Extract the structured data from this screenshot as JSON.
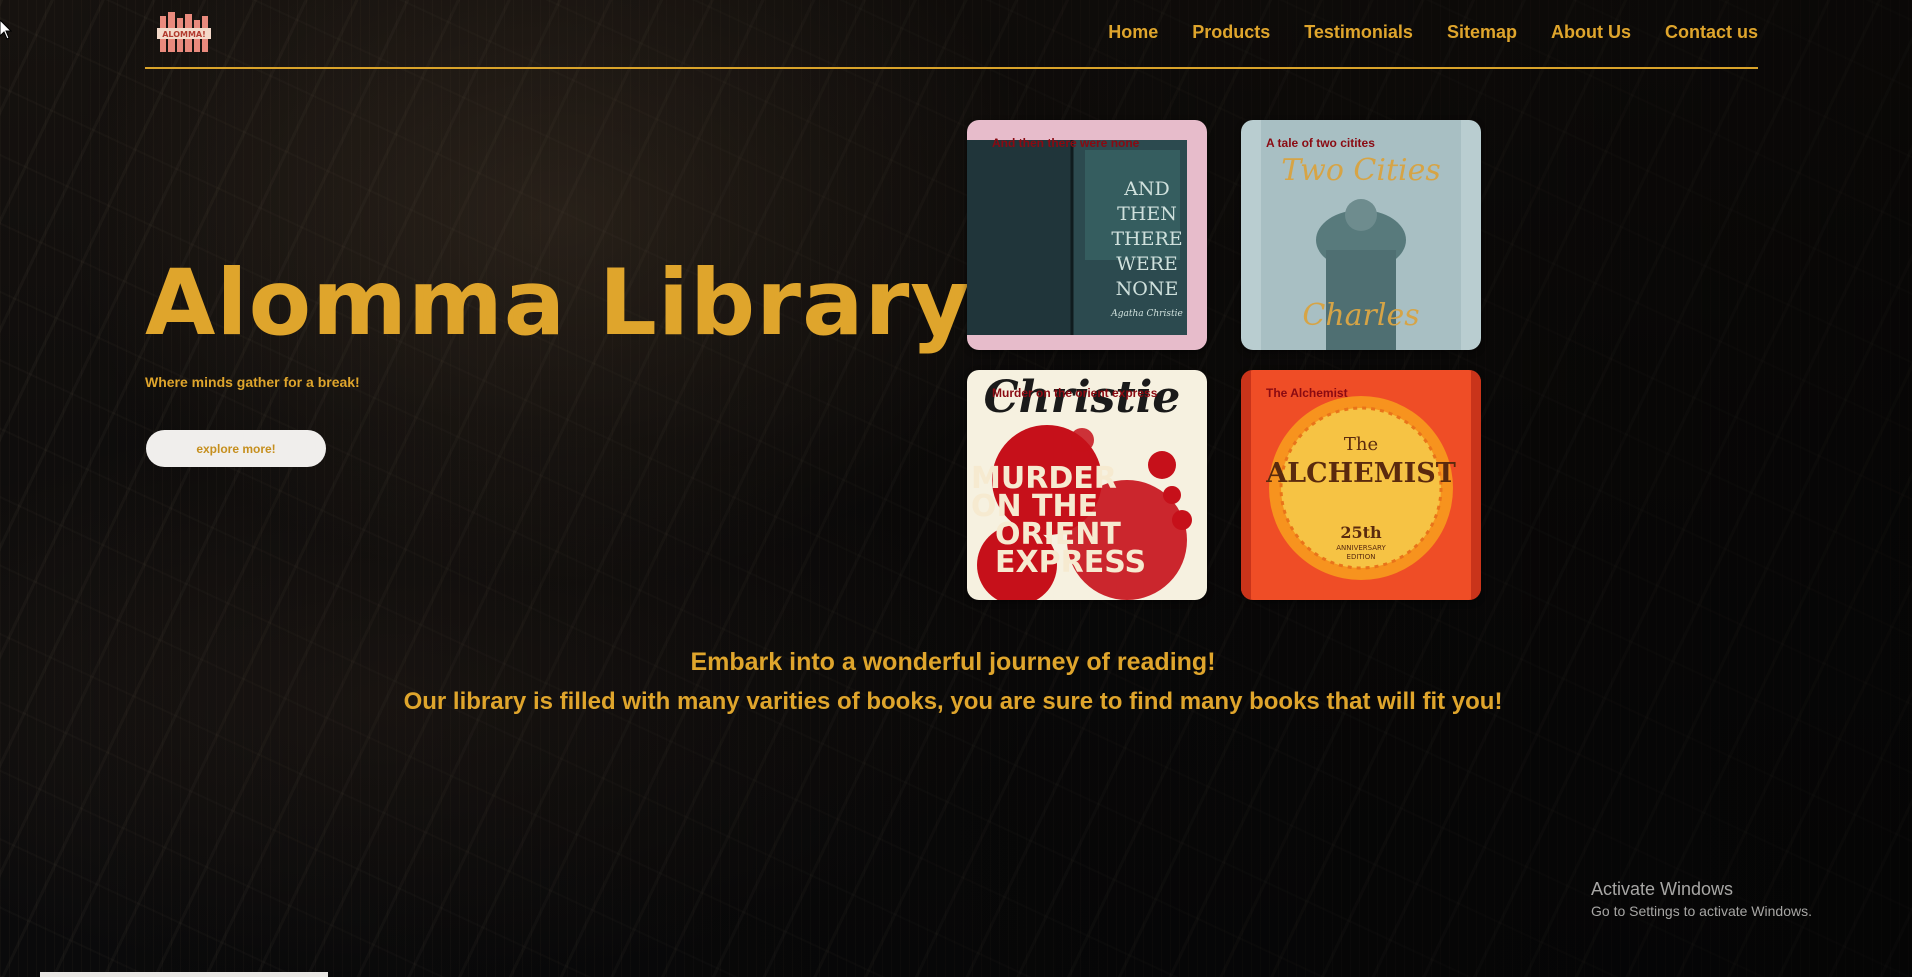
{
  "brand": {
    "logo_text": "ALOMMA!"
  },
  "nav": [
    {
      "label": "Home"
    },
    {
      "label": "Products"
    },
    {
      "label": "Testimonials"
    },
    {
      "label": "Sitemap"
    },
    {
      "label": "About Us"
    },
    {
      "label": "Contact us"
    }
  ],
  "hero": {
    "title": "Alomma Library",
    "tagline": "Where minds gather for a break!",
    "cta_label": "explore more!"
  },
  "books": [
    {
      "caption": "And then there were none",
      "cover_text": [
        "AND",
        "THEN",
        "THERE",
        "WERE",
        "NONE"
      ],
      "author": "Agatha Christie"
    },
    {
      "caption": "A tale of two citites",
      "cover_text": [
        "Two Cities",
        "Charles"
      ]
    },
    {
      "caption": "Murder on the orient express",
      "cover_text": [
        "Christie",
        "MURDER",
        "ON THE",
        "ORIENT",
        "EXPRESS"
      ]
    },
    {
      "caption": "The Alchemist",
      "cover_text": [
        "The",
        "ALCHEMIST",
        "25th",
        "ANNIVERSARY",
        "EDITION"
      ]
    }
  ],
  "promo": {
    "line1": "Embark into a wonderful journey of reading!",
    "line2": "Our library is filled with many varities of books, you are sure to find many books that will fit you!"
  },
  "os_overlay": {
    "title": "Activate Windows",
    "subtitle": "Go to Settings to activate Windows."
  },
  "colors": {
    "accent": "#dfa52c",
    "background": "#0d0c0b",
    "caption": "#8a0a12"
  }
}
